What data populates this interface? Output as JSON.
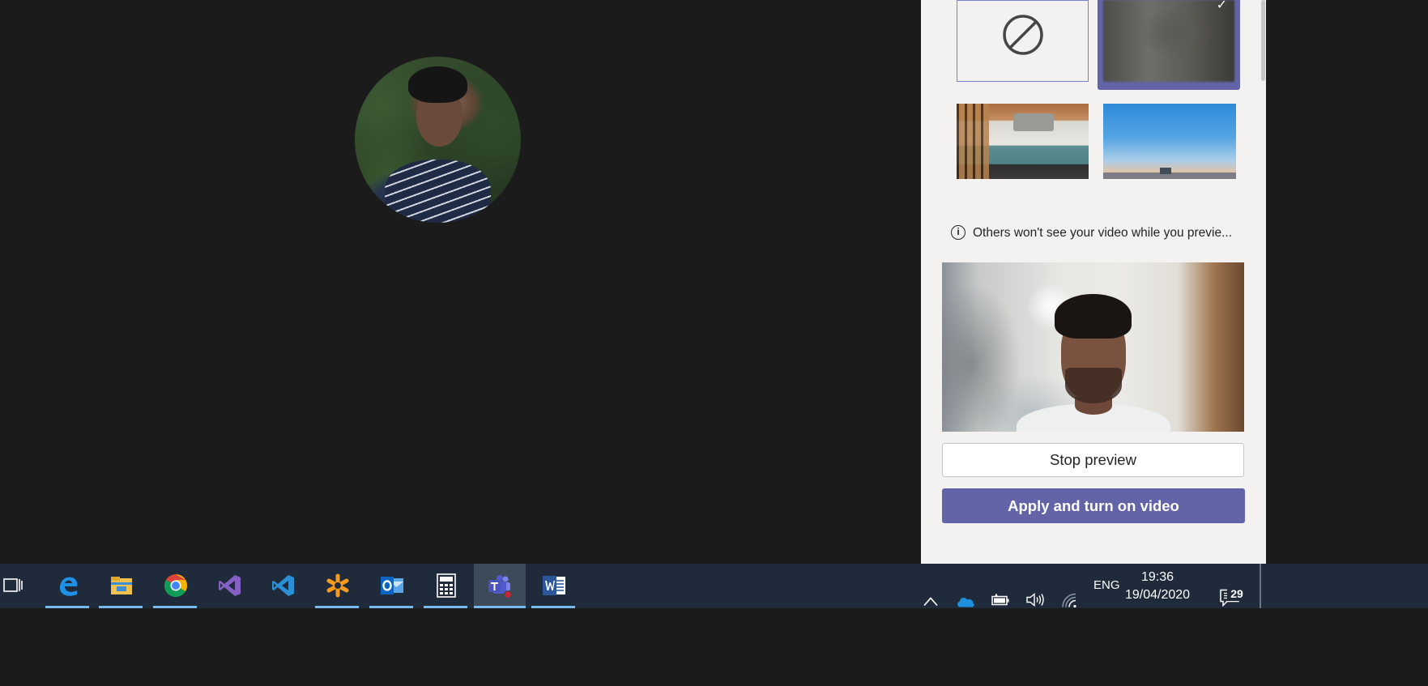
{
  "panel": {
    "background_options": [
      {
        "name": "None",
        "selected": false
      },
      {
        "name": "Blur",
        "selected": true
      },
      {
        "name": "Office"
      },
      {
        "name": "Sky"
      }
    ],
    "notice_text": "Others won't see your video while you previe...",
    "stop_preview_label": "Stop preview",
    "apply_label": "Apply and turn on video",
    "accent_color": "#6264a7"
  },
  "taskbar": {
    "apps": [
      {
        "name": "Task View",
        "icon": "task-view-icon"
      },
      {
        "name": "Microsoft Edge",
        "icon": "edge-icon",
        "running": true
      },
      {
        "name": "File Explorer",
        "icon": "file-explorer-icon",
        "running": true
      },
      {
        "name": "Google Chrome",
        "icon": "chrome-icon",
        "running": true
      },
      {
        "name": "Visual Studio",
        "icon": "visual-studio-icon"
      },
      {
        "name": "Visual Studio Code",
        "icon": "vscode-icon"
      },
      {
        "name": "Snipping",
        "icon": "asterisk-app-icon",
        "running": true
      },
      {
        "name": "Outlook",
        "icon": "outlook-icon",
        "running": true
      },
      {
        "name": "Calculator",
        "icon": "calculator-icon",
        "running": true
      },
      {
        "name": "Microsoft Teams",
        "icon": "teams-icon",
        "running": true,
        "active": true
      },
      {
        "name": "Word",
        "icon": "word-icon",
        "running": true
      }
    ],
    "tray": {
      "language": "ENG",
      "time": "19:36",
      "date": "19/04/2020",
      "notification_count": "29"
    }
  }
}
